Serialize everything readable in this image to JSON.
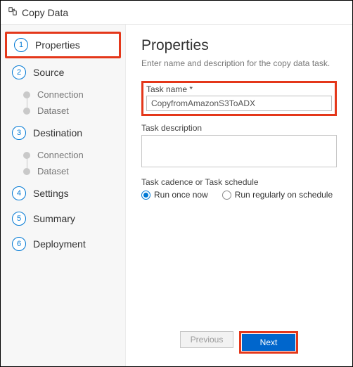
{
  "titlebar": {
    "title": "Copy Data"
  },
  "sidebar": {
    "steps": {
      "properties": "Properties",
      "source": "Source",
      "source_sub_connection": "Connection",
      "source_sub_dataset": "Dataset",
      "destination": "Destination",
      "dest_sub_connection": "Connection",
      "dest_sub_dataset": "Dataset",
      "settings": "Settings",
      "summary": "Summary",
      "deployment": "Deployment"
    },
    "nums": {
      "n1": "1",
      "n2": "2",
      "n3": "3",
      "n4": "4",
      "n5": "5",
      "n6": "6"
    }
  },
  "main": {
    "heading": "Properties",
    "subtitle": "Enter name and description for the copy data task.",
    "task_name_label": "Task name *",
    "task_name_value": "CopyfromAmazonS3ToADX",
    "task_desc_label": "Task description",
    "task_desc_value": "",
    "cadence_label": "Task cadence or Task schedule",
    "radio_once": "Run once now",
    "radio_schedule": "Run regularly on schedule"
  },
  "footer": {
    "previous": "Previous",
    "next": "Next"
  }
}
